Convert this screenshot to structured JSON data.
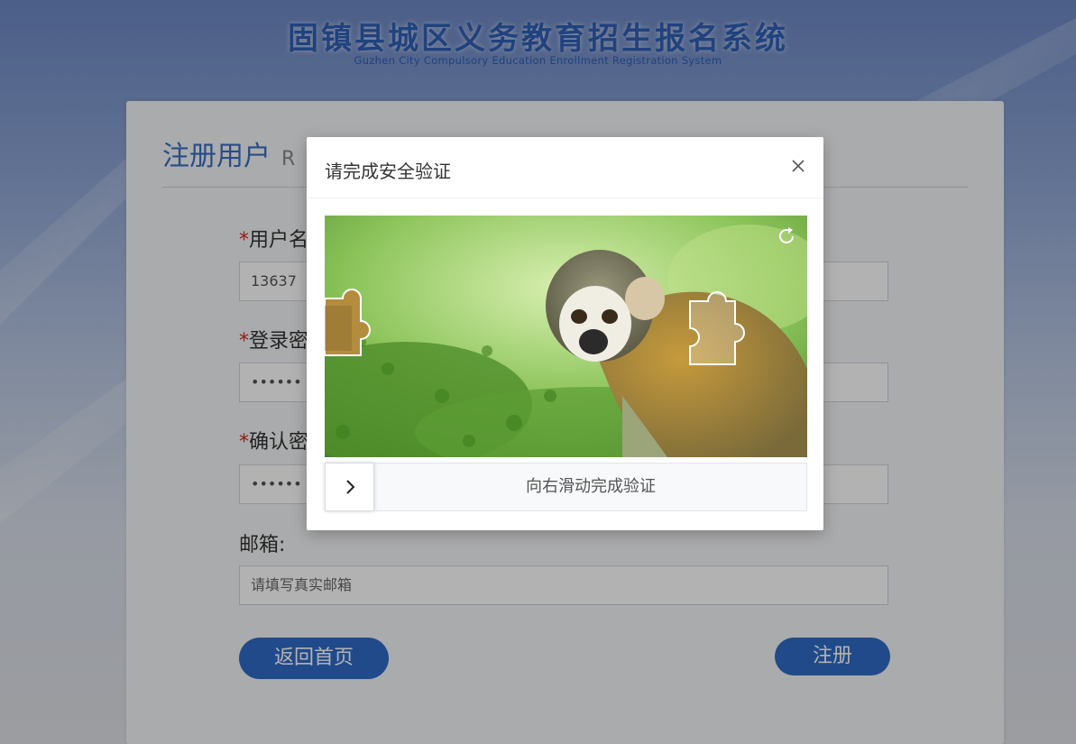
{
  "header": {
    "title_cn": "固镇县城区义务教育招生报名系统",
    "title_en": "Guzhen City Compulsory Education Enrollment Registration System"
  },
  "register_card": {
    "title": "注册用户",
    "title_en_visible": "R",
    "fields": [
      {
        "label": "用户名",
        "required": true,
        "value": "13637"
      },
      {
        "label": "登录密",
        "required": true,
        "value": "••••••"
      },
      {
        "label": "确认密",
        "required": true,
        "value": "••••••"
      },
      {
        "label": "邮箱:",
        "required": false,
        "placeholder": "请填写真实邮箱"
      }
    ],
    "required_mark": "*",
    "back_button": "返回首页",
    "submit_button": "注册"
  },
  "captcha_modal": {
    "title": "请完成安全验证",
    "close_icon": "close-icon",
    "refresh_icon": "refresh-icon",
    "slider_text": "向右滑动完成验证",
    "slider_handle_icon": "chevron-right-icon"
  },
  "colors": {
    "brand_blue": "#2f6ac4",
    "required_red": "#d9251c"
  }
}
